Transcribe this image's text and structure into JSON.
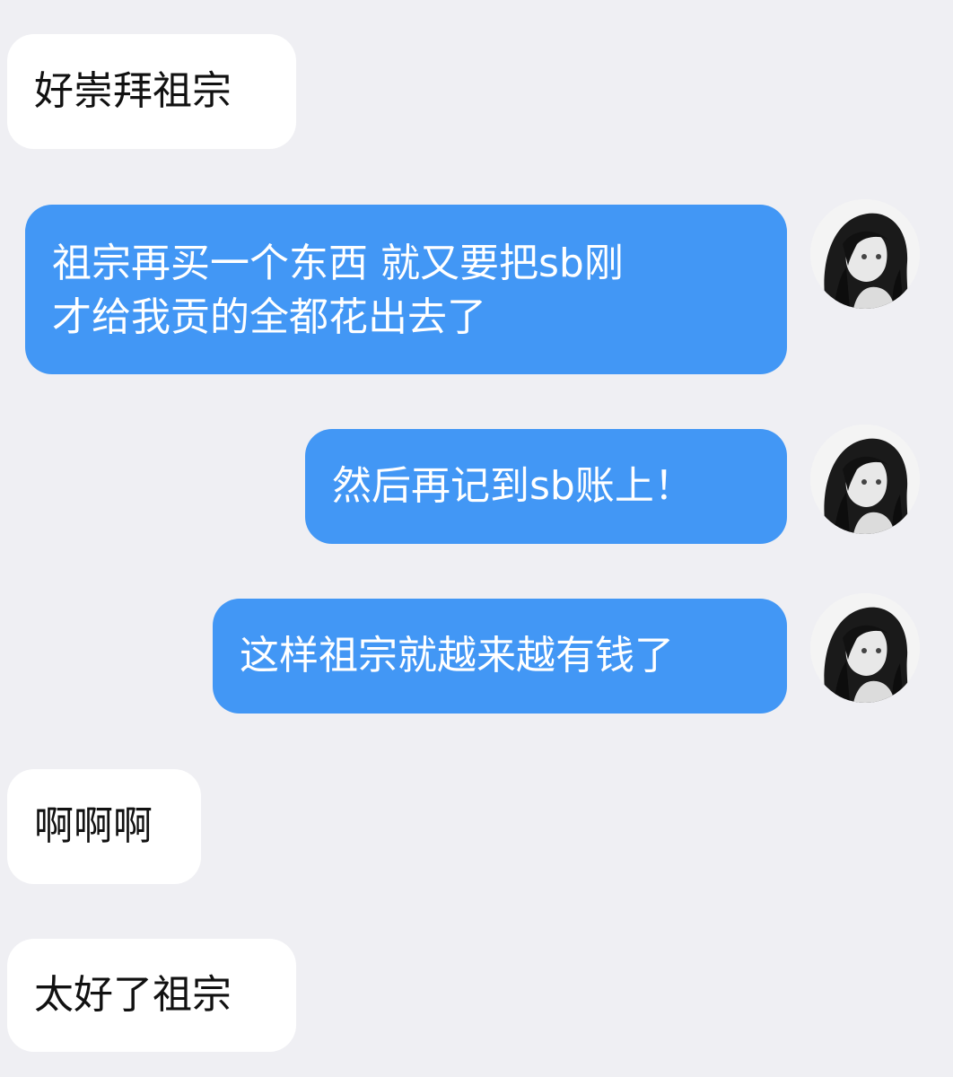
{
  "messages": [
    {
      "side": "incoming",
      "text": "好崇拜祖宗"
    },
    {
      "side": "outgoing",
      "lines": [
        "祖宗再买一个东西 就又要把sb刚",
        "才给我贡的全都花出去了"
      ]
    },
    {
      "side": "outgoing",
      "text": "然后再记到sb账上！"
    },
    {
      "side": "outgoing",
      "text": "这样祖宗就越来越有钱了"
    },
    {
      "side": "incoming",
      "text": "啊啊啊"
    },
    {
      "side": "incoming",
      "text": "太好了祖宗"
    }
  ],
  "avatar": {
    "icon": "girl-portrait-avatar"
  },
  "colors": {
    "background": "#efeff3",
    "incoming_bubble": "#ffffff",
    "outgoing_bubble": "#4297f5",
    "incoming_text": "#111111",
    "outgoing_text": "#ffffff"
  }
}
